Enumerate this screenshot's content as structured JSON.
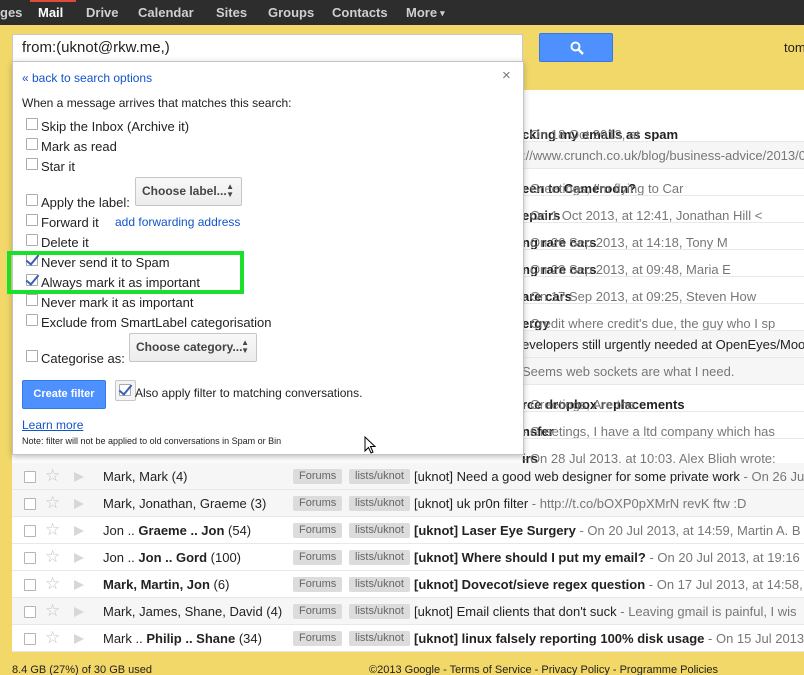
{
  "topbar": {
    "items": [
      "ges",
      "Mail",
      "Drive",
      "Calendar",
      "Sites",
      "Groups",
      "Contacts",
      "More"
    ],
    "active": "Mail",
    "more_caret": "▾"
  },
  "search": {
    "value": "from:(uknot@rkw.me,)",
    "button_icon": "search-icon"
  },
  "user": {
    "name": "tom"
  },
  "filter": {
    "back_link": "« back to search options",
    "close": "×",
    "heading": "When a message arrives that matches this search:",
    "options": [
      {
        "label": "Skip the Inbox (Archive it)",
        "checked": false
      },
      {
        "label": "Mark as read",
        "checked": false
      },
      {
        "label": "Star it",
        "checked": false
      },
      {
        "label": "Apply the label:",
        "checked": false
      },
      {
        "label": "Forward it",
        "checked": false
      },
      {
        "label": "Delete it",
        "checked": false
      },
      {
        "label": "Never send it to Spam",
        "checked": true
      },
      {
        "label": "Always mark it as important",
        "checked": true
      },
      {
        "label": "Never mark it as important",
        "checked": false
      },
      {
        "label": "Exclude from SmartLabel categorisation",
        "checked": false
      },
      {
        "label": "Categorise as:",
        "checked": false
      }
    ],
    "choose_label": "Choose label...",
    "add_forwarding": "add forwarding address",
    "choose_category": "Choose category...",
    "create_button": "Create filter",
    "apply_matching": "Also apply filter to matching conversations.",
    "apply_matching_checked": true,
    "learn_more": "Learn more",
    "note": "Note: filter will not be applied to old conversations in Spam or Bin",
    "highlight_color": "#19e02a"
  },
  "emails_partial": [
    {
      "subject": "cking my emails as spam",
      "snippet": " - On 18 Oct 2013, at",
      "unread": true
    },
    {
      "subject": "",
      "snippet": "://www.crunch.co.uk/blog/business-advice/2013/0",
      "unread": false
    },
    {
      "subject": "een to Cameroon?",
      "snippet": " - Greetings, I'm flying to Car",
      "unread": true
    },
    {
      "subject": "epairs",
      "snippet": " - On 1 Oct 2013, at 12:41, Jonathan Hill <",
      "unread": true
    },
    {
      "subject": "ng rare cars",
      "snippet": " - On 26 Sep 2013, at 14:18, Tony M",
      "unread": true
    },
    {
      "subject": "ng rare cars",
      "snippet": " - On 23 Sep 2013, at 09:48, Maria E",
      "unread": true
    },
    {
      "subject": "are cars",
      "snippet": " - On 17 Sep 2013, at 09:25, Steven How",
      "unread": true
    },
    {
      "subject": "ergy",
      "snippet": " - Credit where credit's due, the guy who I sp",
      "unread": true
    },
    {
      "subject": "",
      "snippet": "evelopers still urgently needed at OpenEyes/Moo",
      "unread": false
    },
    {
      "subject": "",
      "snippet": "Seems web sockets are what I need.",
      "unread": false
    },
    {
      "subject": "rce dropbox replacements",
      "snippet": " - Greetings, Are the",
      "unread": true
    },
    {
      "subject": "nsfer",
      "snippet": " - Greetings, I have a ltd company which has",
      "unread": true
    },
    {
      "subject": "irs",
      "snippet": " - On 28 Jul 2013, at 10:03, Alex Bligh wrote:",
      "unread": true
    }
  ],
  "emails_full": [
    {
      "sender": "Mark, Mark (4)",
      "label1": "Forums",
      "label2": "lists/uknot",
      "subject": "[uknot] Need a good web designer for some private work",
      "snippet": " - On 26 Jul",
      "unread": false
    },
    {
      "sender": "Mark, Jonathan, Graeme (3)",
      "label1": "Forums",
      "label2": "lists/uknot",
      "subject": "[uknot] uk pr0n filter",
      "snippet": " - http://t.co/bOXP0pXMrN revK ftw :D",
      "unread": false
    },
    {
      "sender_pre": "Jon .. ",
      "sender_bold": "Graeme .. Jon",
      "sender_post": " (54)",
      "label1": "Forums",
      "label2": "lists/uknot",
      "subject": "[uknot] Laser Eye Surgery",
      "snippet": " - On 20 Jul 2013, at 14:59, Martin A. B",
      "unread": true
    },
    {
      "sender_pre": "Jon .. ",
      "sender_bold": "Jon .. Gord",
      "sender_post": " (100)",
      "label1": "Forums",
      "label2": "lists/uknot",
      "subject": "[uknot] Where should I put my email?",
      "snippet": " - On 20 Jul 2013, at 19:16",
      "unread": true
    },
    {
      "sender_pre": "",
      "sender_bold": "Mark, Martin, Jon",
      "sender_post": " (6)",
      "label1": "Forums",
      "label2": "lists/uknot",
      "subject": "[uknot] Dovecot/sieve regex question",
      "snippet": " - On 17 Jul 2013, at 14:58,",
      "unread": true
    },
    {
      "sender": "Mark, James, Shane, David (4)",
      "label1": "Forums",
      "label2": "lists/uknot",
      "subject": "[uknot] Email clients that don't suck",
      "snippet": " - Leaving gmail is painful, I wis",
      "unread": false
    },
    {
      "sender_pre": "Mark .. ",
      "sender_bold": "Philip .. Shane",
      "sender_post": " (34)",
      "label1": "Forums",
      "label2": "lists/uknot",
      "subject": "[uknot] linux falsely reporting 100% disk usage",
      "snippet": " - On 15 Jul 2013",
      "unread": true
    }
  ],
  "footer": {
    "storage": "8.4 GB (27%) of 30 GB used",
    "links": "©2013 Google - Terms of Service - Privacy Policy - Programme Policies"
  }
}
